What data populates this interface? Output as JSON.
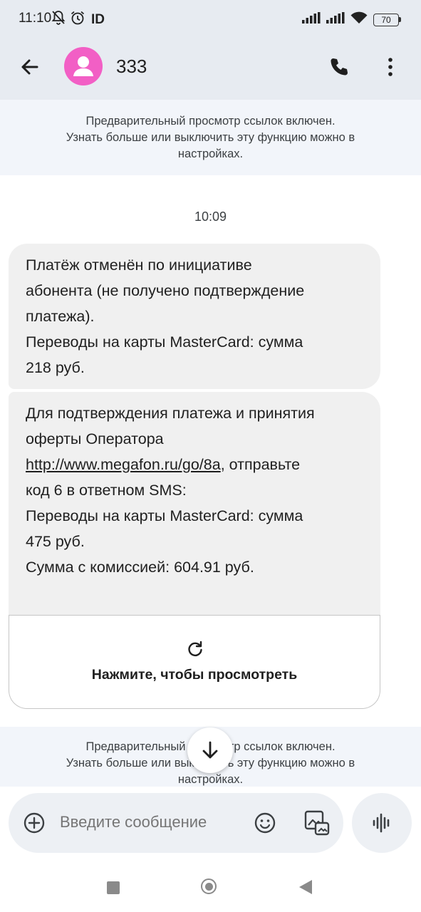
{
  "status_bar": {
    "time": "11:10",
    "indicator": "ID",
    "battery": "70"
  },
  "header": {
    "contact_name": "333"
  },
  "notices": {
    "top": [
      "Предварительный просмотр ссылок включен.",
      "Узнать больше или выключить эту функцию можно в",
      "настройках."
    ],
    "bottom": [
      "Предварительный просмотр ссылок включен.",
      "Узнать больше или выключить эту функцию можно в",
      "настройках."
    ]
  },
  "conversation": {
    "timestamp": "10:09",
    "message_1": {
      "lines": [
        "Платёж отменён по инициативе",
        "абонента (не получено подтверждение",
        "платежа).",
        "Переводы на карты MasterCard: сумма",
        "218 руб."
      ]
    },
    "message_2": {
      "line_1": "Для подтверждения платежа и принятия",
      "line_2": "оферты  Оператора",
      "link": "http://www.megafon.ru/go/8a",
      "link_suffix": ", отправьте",
      "line_4": "код 6 в ответном SMS:",
      "line_5": "Переводы на карты MasterCard: сумма",
      "line_6": "475 руб.",
      "line_7": "Сумма с комиссией: 604.91 руб."
    },
    "preview": {
      "label": "Нажмите, чтобы просмотреть"
    }
  },
  "composer": {
    "placeholder": "Введите сообщение"
  },
  "icons": {
    "back": "arrow-back-icon",
    "avatar": "person-icon",
    "call": "phone-icon",
    "more": "more-vert-icon",
    "refresh": "refresh-icon",
    "scroll": "arrow-down-icon",
    "add": "add-circle-icon",
    "emoji": "emoji-icon",
    "gallery": "gallery-icon",
    "voice": "voice-waveform-icon"
  },
  "colors": {
    "avatar": "#f25fc5",
    "header_bg": "#e7ebf1",
    "bubble_bg": "#f0f0f0"
  }
}
